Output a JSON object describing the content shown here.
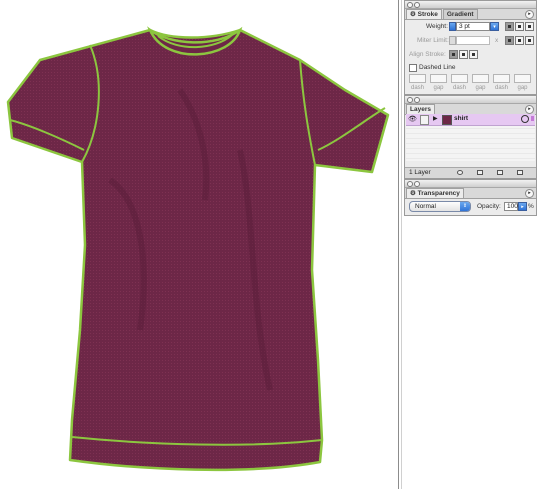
{
  "artwork": {
    "shirt_color": "#6d2747",
    "outline_color": "#8cc63f"
  },
  "stroke_panel": {
    "tabs": [
      "Stroke",
      "Gradient"
    ],
    "weight_label": "Weight:",
    "weight_value": "3 pt",
    "miter_label": "Miter Limit:",
    "miter_unit": "x",
    "align_label": "Align Stroke:",
    "dashed_label": "Dashed Line",
    "dash_labels": [
      "dash",
      "gap",
      "dash",
      "gap",
      "dash",
      "gap"
    ]
  },
  "layers_panel": {
    "tab": "Layers",
    "layer_name": "shirt",
    "layer_color": "#e6c8f2",
    "footer_count": "1 Layer"
  },
  "transparency_panel": {
    "tab": "Transparency",
    "blend_mode": "Normal",
    "opacity_label": "Opacity:",
    "opacity_value": "100",
    "opacity_unit": "%"
  }
}
